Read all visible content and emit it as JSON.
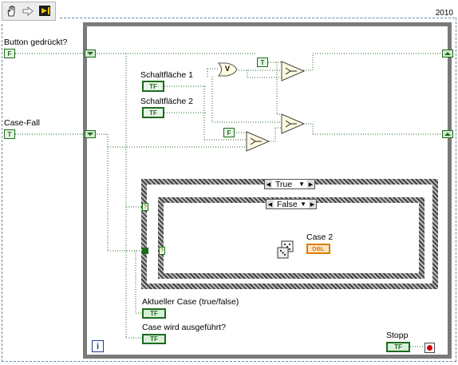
{
  "toolbar": {
    "items": [
      {
        "icon": "hand-icon"
      },
      {
        "icon": "arrow-right-icon"
      },
      {
        "icon": "cleanup-icon"
      }
    ]
  },
  "version_label": "2010",
  "controls": {
    "button_gedrueckt": {
      "label": "Button gedrückt?",
      "const": "F"
    },
    "case_fall": {
      "label": "Case-Fall",
      "const": "T"
    },
    "schaltflaeche1": {
      "label": "Schaltfläche 1",
      "type": "TF"
    },
    "schaltflaeche2": {
      "label": "Schaltfläche 2",
      "type": "TF"
    },
    "const_true": "T",
    "const_false": "F",
    "or_gate": "V"
  },
  "case_structure": {
    "outer_selector": "True",
    "inner_selector": "False",
    "inner_label": "Case 2",
    "dbl_type": "DBL"
  },
  "indicators": {
    "aktueller_case": {
      "label": "Aktueller Case (true/false)",
      "type": "TF"
    },
    "case_ausgefuehrt": {
      "label": "Case wird ausgeführt?",
      "type": "TF"
    },
    "stopp": {
      "label": "Stopp",
      "type": "TF"
    }
  },
  "loop": {
    "iteration": "i"
  },
  "colors": {
    "bool_wire": "#1d6b1d",
    "dbl_wire": "#e07b00",
    "frame": "#7a7a7a",
    "loop_border": "#6a89a8"
  }
}
